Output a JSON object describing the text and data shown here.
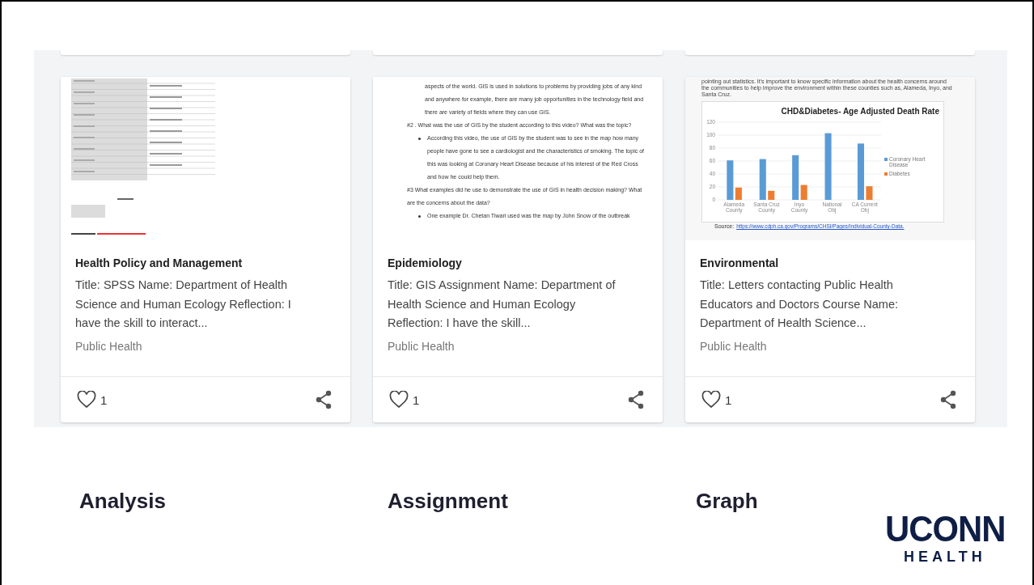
{
  "cards": [
    {
      "preview": {
        "kind": "table-output"
      },
      "title": "Health Policy and Management",
      "description": "Title: SPSS Name: Department of Health Science and Human Ecology Reflection: I have the skill to interact...",
      "category": "Public Health",
      "likes": "1"
    },
    {
      "preview": {
        "kind": "document",
        "paragraphs": [
          {
            "kind": "text",
            "text": "aspects of the world. GIS is used in solutions to problems by providing jobs of any kind and anywhere for example, there are many job opportunities in the technology field and there are variety of fields where they can use GIS."
          },
          {
            "kind": "question",
            "text": "#2 .  What was the use of GIS by the student according to this video?  What was the topic?"
          },
          {
            "kind": "bullet",
            "text": "According this video, the use of GIS by the student was to see in the map how many people have gone to see a cardiologist and the characteristics of smoking. The topic of this was looking at Coronary Heart Disease because of his interest of the Red Cross and how he could help them."
          },
          {
            "kind": "question",
            "text": "#3 What examples did he use to demonstrate the use of GIS in health decision making? What are the concerns about the data?"
          },
          {
            "kind": "bullet",
            "text": "One example Dr. Chetan Tiwari used was the map by John Snow of the outbreak"
          }
        ]
      },
      "title": "Epidemiology",
      "description": "Title: GIS Assignment Name: Department of Health Science and Human Ecology Reflection: I have the skill...",
      "category": "Public Health",
      "likes": "1"
    },
    {
      "preview": {
        "kind": "chart",
        "intro": "pointing out statistics. It's important to know specific information about the health concerns around the communities to help improve the environment within these counties such as, Alameda, Inyo, and Santa Cruz.",
        "chart_data": {
          "type": "bar",
          "grid": true,
          "legend": true,
          "title": "CHD&Diabetes- Age Adjusted Death Rate",
          "categories": [
            "Alameda County",
            "Santa Cruz County",
            "Inyo County",
            "National Obj",
            "CA Current Obj"
          ],
          "ylim": [
            0,
            120
          ],
          "yticks": [
            0,
            20,
            40,
            60,
            80,
            100,
            120
          ],
          "series": [
            {
              "name": "Coronary Heart Disease",
              "color": "#5b9bd5",
              "values": [
                61,
                63,
                69,
                103,
                87
              ]
            },
            {
              "name": "Diabetes",
              "color": "#ed7d31",
              "values": [
                19,
                14,
                23,
                null,
                21
              ]
            }
          ]
        },
        "source_label": "Source:",
        "source_link": "https://www.cdph.ca.gov/Programs/CHSI/Pages/Individual-County-Data."
      },
      "title": "Environmental",
      "description": "Title: Letters contacting Public Health Educators and Doctors Course Name: Department of Health Science...",
      "category": "Public Health",
      "likes": "1"
    }
  ],
  "captions": [
    "Analysis",
    "Assignment",
    "Graph"
  ],
  "logo": {
    "wordmark": "UCONN",
    "subtitle": "HEALTH"
  }
}
